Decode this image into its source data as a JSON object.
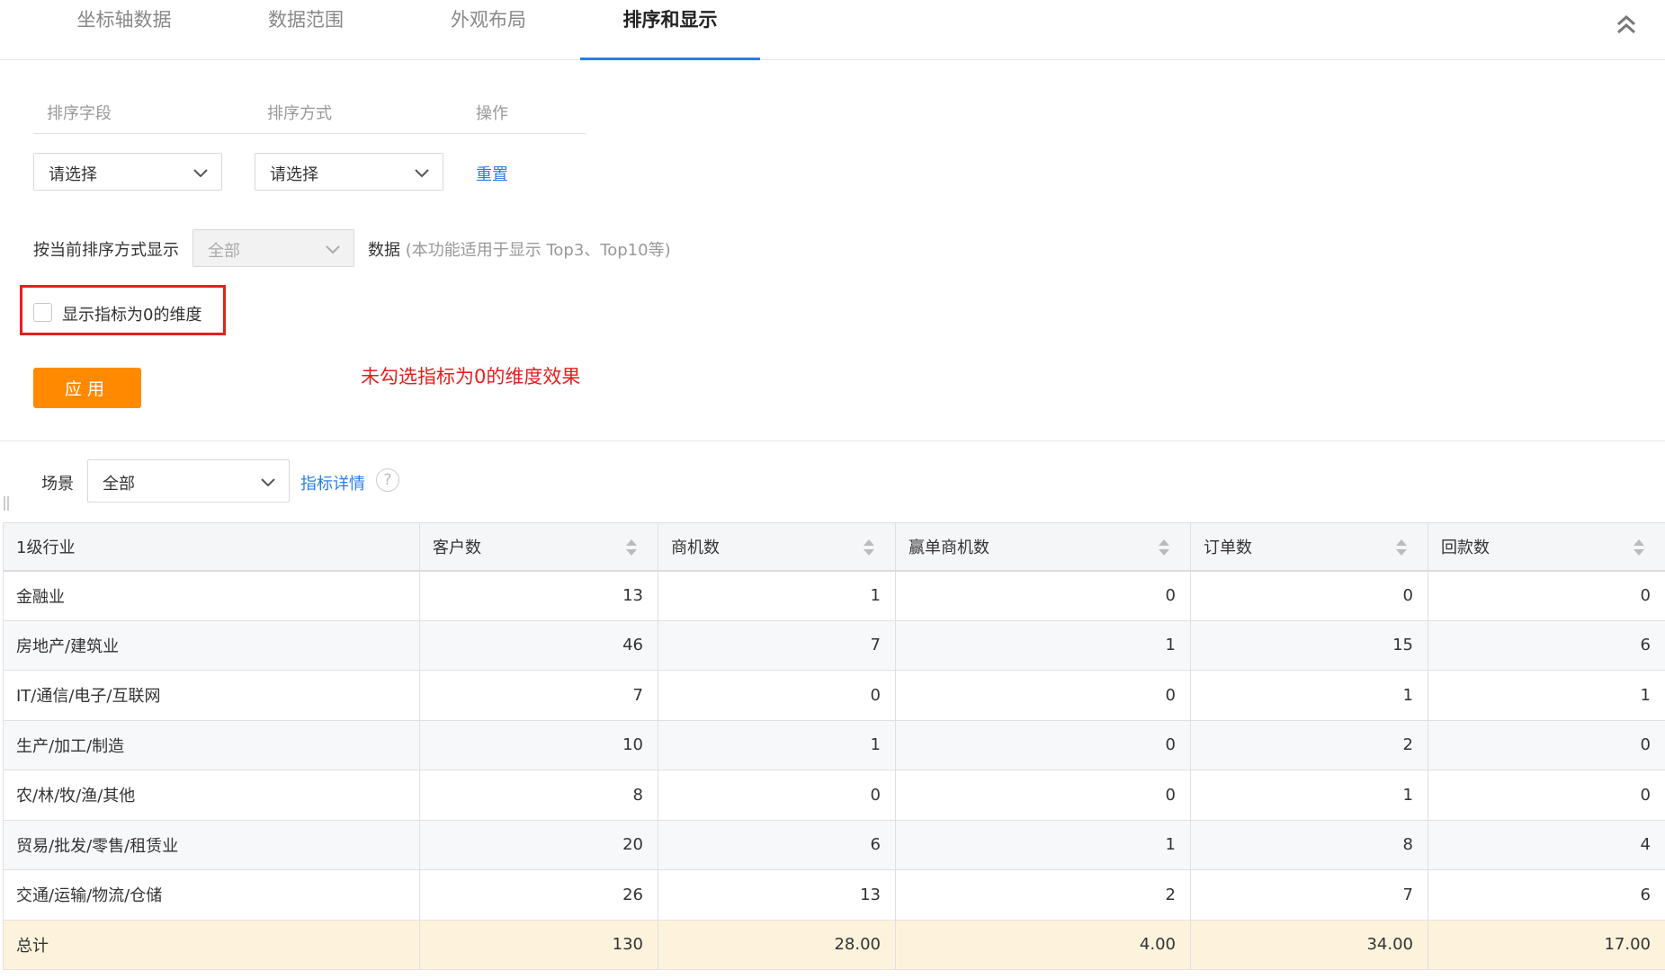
{
  "tabs": [
    {
      "label": "坐标轴数据"
    },
    {
      "label": "数据范围"
    },
    {
      "label": "外观布局"
    },
    {
      "label": "排序和显示"
    }
  ],
  "sort": {
    "headers": {
      "field": "排序字段",
      "method": "排序方式",
      "action": "操作"
    },
    "field_select": "请选择",
    "method_select": "请选择",
    "reset_label": "重置"
  },
  "display": {
    "prefix": "按当前排序方式显示",
    "select_value": "全部",
    "suffix": "数据",
    "hint": "(本功能适用于显示 Top3、Top10等)"
  },
  "checkbox_label": "显示指标为0的维度",
  "apply_label": "应用",
  "annotation": "未勾选指标为0的维度效果",
  "scene": {
    "label": "场景",
    "select_value": "全部",
    "detail_link": "指标详情",
    "help_icon": "?"
  },
  "table": {
    "columns": [
      "1级行业",
      "客户数",
      "商机数",
      "赢单商机数",
      "订单数",
      "回款数"
    ],
    "rows": [
      [
        "金融业",
        "13",
        "1",
        "0",
        "0",
        "0"
      ],
      [
        "房地产/建筑业",
        "46",
        "7",
        "1",
        "15",
        "6"
      ],
      [
        "IT/通信/电子/互联网",
        "7",
        "0",
        "0",
        "1",
        "1"
      ],
      [
        "生产/加工/制造",
        "10",
        "1",
        "0",
        "2",
        "0"
      ],
      [
        "农/林/牧/渔/其他",
        "8",
        "0",
        "0",
        "1",
        "0"
      ],
      [
        "贸易/批发/零售/租赁业",
        "20",
        "6",
        "1",
        "8",
        "4"
      ],
      [
        "交通/运输/物流/仓储",
        "26",
        "13",
        "2",
        "7",
        "6"
      ]
    ],
    "total": [
      "总计",
      "130",
      "28.00",
      "4.00",
      "34.00",
      "17.00"
    ]
  },
  "colors": {
    "accent": "#2b7de9",
    "apply_button": "#ff8a00",
    "annotation_red": "#e61f1f",
    "total_row": "#fdf3dc"
  }
}
